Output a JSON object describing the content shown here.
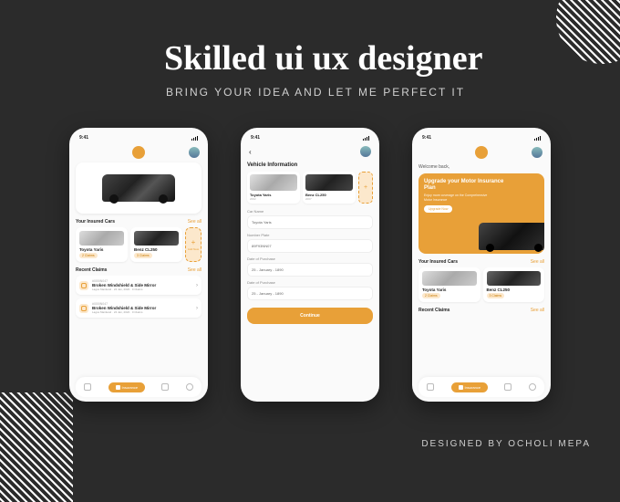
{
  "headline": "Skilled ui ux designer",
  "subhead": "BRING YOUR IDEA AND LET ME PERFECT IT",
  "credit": "DESIGNED BY OCHOLI MEPA",
  "status_time": "9:41",
  "phone1": {
    "section_cars": "Your Insured Cars",
    "see_all": "See all",
    "car1_name": "Toyota Yaris",
    "car1_claims": "2 Claims",
    "car2_name": "Benz CL250",
    "car2_claims": "3 Claims",
    "add_new": "Add New",
    "section_claims": "Recent Claims",
    "claim_ref": "#000IN047",
    "claim_title": "Broken Windshield & Side Mirror",
    "claim_meta": "Lagos Mainland · 24 Jan, 2022 · 0 Claims",
    "nav_label": "Insurance"
  },
  "phone2": {
    "header": "Vehicle Information",
    "v1_name": "Toyota Yaris",
    "v1_year": "2002",
    "v2_name": "Benz CL250",
    "v2_year": "2007",
    "label_car": "Car Name",
    "val_car": "Toyota Yaris",
    "label_plate": "Number Plate",
    "val_plate": "89F93NN07",
    "label_dop": "Date of Purchase",
    "val_dop": "25 - January - 1890",
    "label_dop2": "Date of Purchase",
    "val_dop2": "25 - January - 1890",
    "cta": "Continue"
  },
  "phone3": {
    "welcome": "Welcome back,",
    "promo_title": "Upgrade your Motor Insurance Plan",
    "promo_desc": "Enjoy more coverage on the Comprehensive Motor Insurance",
    "promo_btn": "Upgrade Now",
    "section_cars": "Your Insured Cars",
    "see_all": "See all",
    "car1_name": "Toyota Yaris",
    "car1_claims": "2 Claims",
    "car2_name": "Benz CL250",
    "car2_claims": "3 Claims",
    "section_claims": "Recent Claims",
    "nav_label": "Insurance"
  }
}
